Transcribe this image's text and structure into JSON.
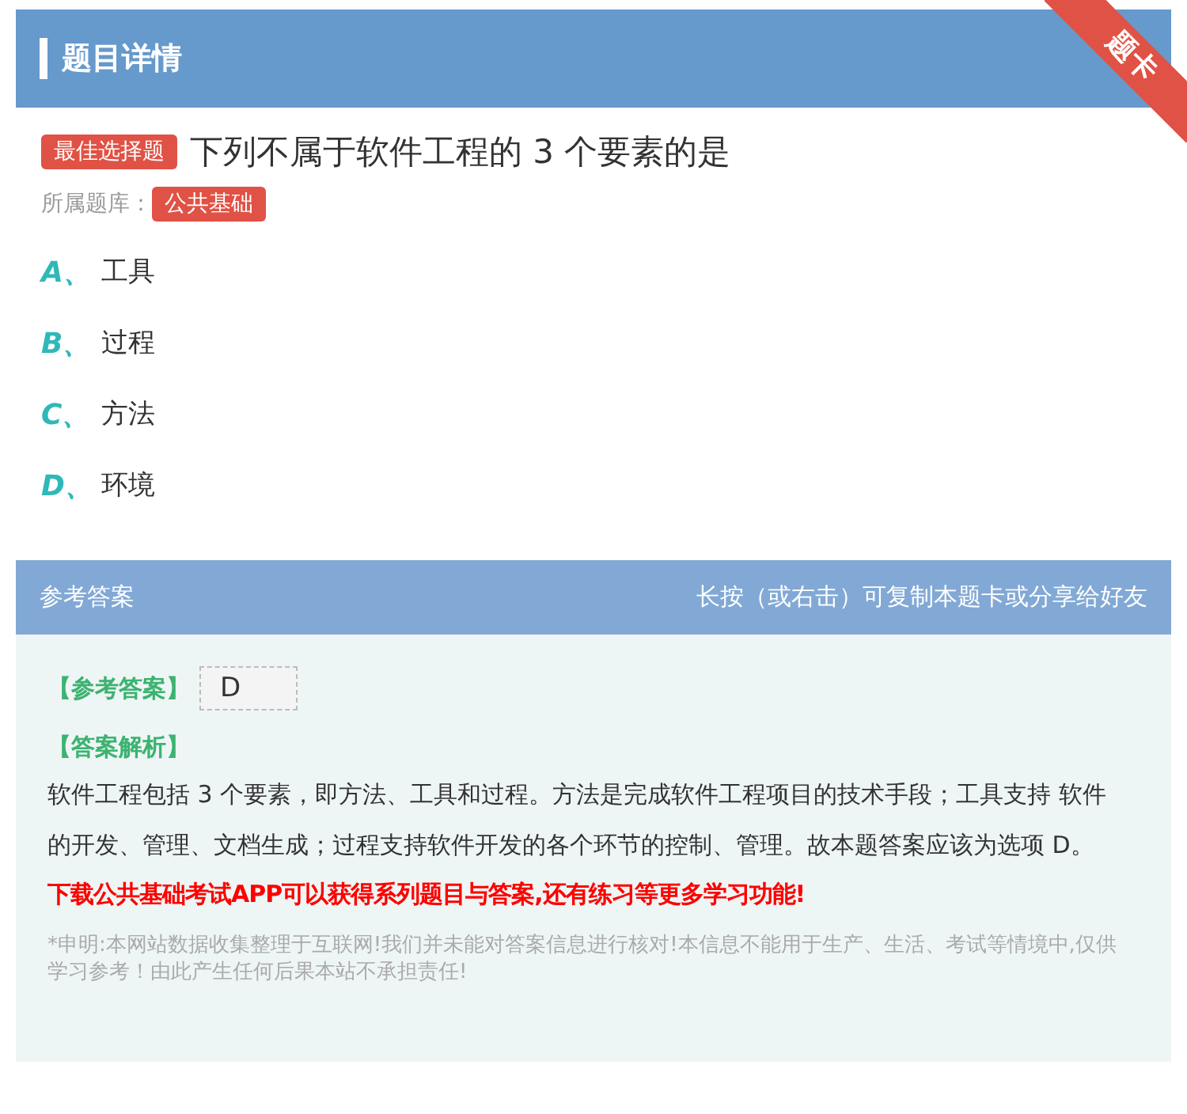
{
  "header": {
    "title": "题目详情",
    "ribbon": "题卡"
  },
  "question": {
    "type_badge": "最佳选择题",
    "text": "下列不属于软件工程的 3 个要素的是",
    "bank_label": "所属题库：",
    "bank": "公共基础"
  },
  "options": [
    {
      "letter": "A、",
      "text": "工具"
    },
    {
      "letter": "B、",
      "text": "过程"
    },
    {
      "letter": "C、",
      "text": "方法"
    },
    {
      "letter": "D、",
      "text": "环境"
    }
  ],
  "answer_panel": {
    "title": "参考答案",
    "hint": "长按（或右击）可复制本题卡或分享给好友",
    "answer_label": "【参考答案】",
    "answer": "D",
    "analysis_label": "【答案解析】",
    "analysis": "软件工程包括 3 个要素，即方法、工具和过程。方法是完成软件工程项目的技术手段；工具支持 软件的开发、管理、文档生成；过程支持软件开发的各个环节的控制、管理。故本题答案应该为选项 D。",
    "promo": "下载公共基础考试APP可以获得系列题目与答案,还有练习等更多学习功能!",
    "disclaimer": "*申明:本网站数据收集整理于互联网!我们并未能对答案信息进行核对!本信息不能用于生产、生活、考试等情境中,仅供学习参考！由此产生任何后果本站不承担责任!"
  }
}
